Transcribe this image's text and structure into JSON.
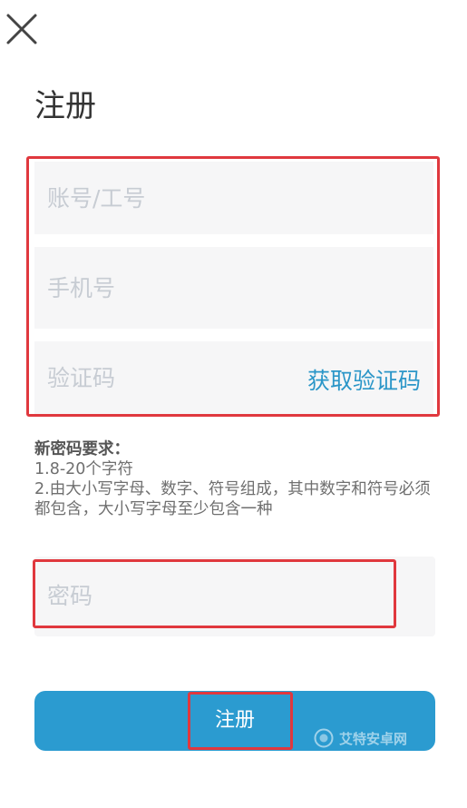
{
  "header": {
    "close_icon": "close-icon",
    "title": "注册"
  },
  "form": {
    "account_placeholder": "账号/工号",
    "phone_placeholder": "手机号",
    "code_placeholder": "验证码",
    "get_code_label": "获取验证码",
    "password_placeholder": "密码"
  },
  "requirements": {
    "title": "新密码要求：",
    "line1": "1.8-20个字符",
    "line2": "2.由大小写字母、数字、符号组成，其中数字和符号必须都包含，大小写字母至少包含一种"
  },
  "submit": {
    "label": "注册"
  },
  "watermark": {
    "text": "艾特安卓网"
  },
  "colors": {
    "accent": "#2b9bd0",
    "link": "#2b96c8",
    "highlight_box": "#e0383e",
    "field_bg": "#f6f6f7",
    "placeholder": "#c7ccd3"
  }
}
